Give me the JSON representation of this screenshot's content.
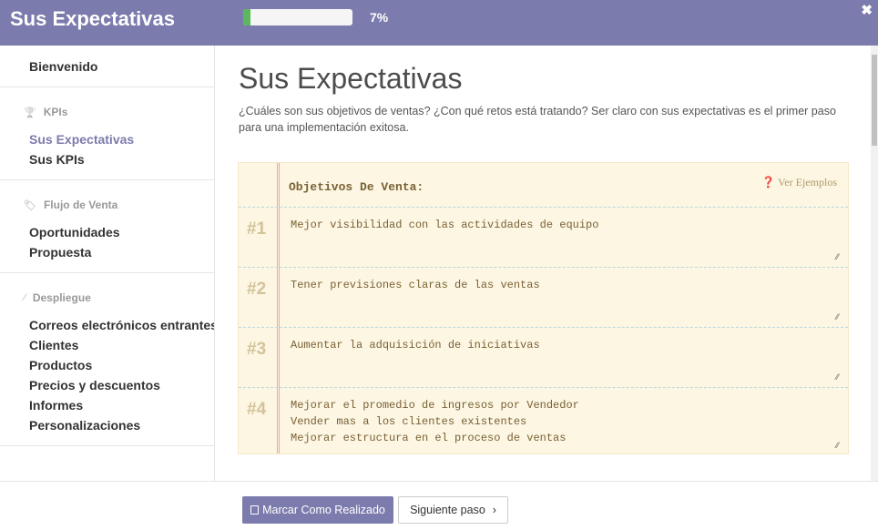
{
  "header": {
    "title": "Sus Expectativas",
    "progress_percent": 7,
    "progress_label": "7%",
    "close_icon": "close-icon"
  },
  "sidebar": {
    "top": {
      "label": "Bienvenido"
    },
    "sections": [
      {
        "title": "KPIs",
        "icon": "trophy-icon",
        "items": [
          {
            "label": "Sus Expectativas",
            "active": true
          },
          {
            "label": "Sus KPIs"
          }
        ]
      },
      {
        "title": "Flujo de Venta",
        "icon": "tag-icon",
        "items": [
          {
            "label": "Oportunidades"
          },
          {
            "label": "Propuesta"
          }
        ]
      },
      {
        "title": "Despliegue",
        "icon": "magic-wand-icon",
        "items": [
          {
            "label": "Correos electrónicos entrantes"
          },
          {
            "label": "Clientes"
          },
          {
            "label": "Productos"
          },
          {
            "label": "Precios y descuentos"
          },
          {
            "label": "Informes"
          },
          {
            "label": "Personalizaciones"
          }
        ]
      }
    ]
  },
  "main": {
    "title": "Sus Expectativas",
    "description": "¿Cuáles son sus objetivos de ventas? ¿Con qué retos está tratando? Ser claro con sus expectativas es el primer paso para una implementación exitosa.",
    "notebook": {
      "title": "Objetivos De Venta:",
      "examples_link": "Ver Ejemplos",
      "rows": [
        {
          "num": "#1",
          "value": "Mejor visibilidad con las actividades de equipo"
        },
        {
          "num": "#2",
          "value": "Tener previsiones claras de las ventas"
        },
        {
          "num": "#3",
          "value": "Aumentar la adquisición de iniciativas"
        },
        {
          "num": "#4",
          "value": "Mejorar el promedio de ingresos por Vendedor\nVender mas a los clientes existentes\nMejorar estructura en el proceso de ventas"
        }
      ]
    }
  },
  "footer": {
    "done_label": "Marcar Como Realizado",
    "next_label": "Siguiente paso"
  },
  "colors": {
    "brand": "#7c7bad",
    "progress": "#5cb85c",
    "notebook_bg": "#fcf6e2"
  }
}
